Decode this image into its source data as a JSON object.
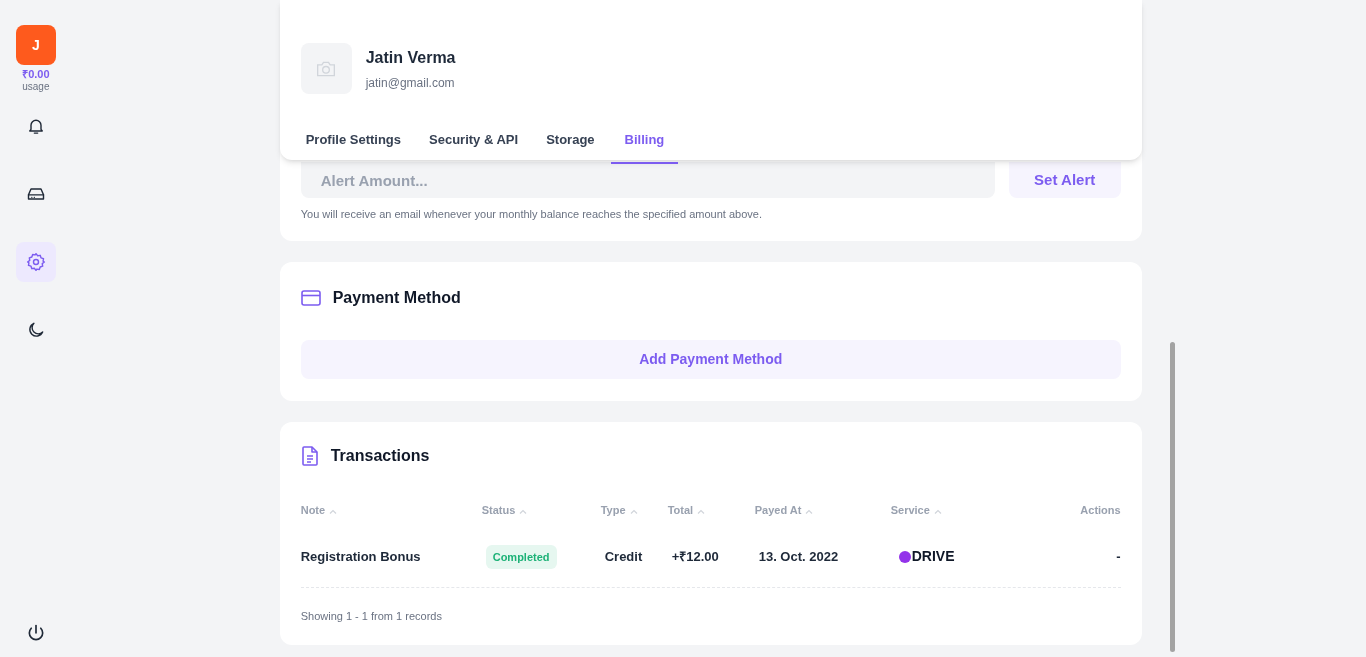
{
  "sidebar": {
    "avatar": "J",
    "usage_amount": "₹0.00",
    "usage_label": "usage",
    "items": [
      {
        "kind": "bell",
        "selected": false
      },
      {
        "kind": "drive",
        "selected": false
      },
      {
        "kind": "gear",
        "selected": true
      },
      {
        "kind": "moon",
        "selected": false
      }
    ]
  },
  "profile": {
    "name": "Jatin Verma",
    "email": "jatin@gmail.com"
  },
  "tabs": [
    {
      "label": "Profile Settings",
      "selected": false
    },
    {
      "label": "Security & API",
      "selected": false
    },
    {
      "label": "Storage",
      "selected": false
    },
    {
      "label": "Billing",
      "selected": true
    }
  ],
  "alert": {
    "placeholder": "Alert Amount...",
    "button": "Set Alert",
    "hint": "You will receive an email whenever your monthly balance reaches the specified amount above."
  },
  "payment": {
    "title": "Payment Method",
    "button": "Add Payment Method"
  },
  "transactions": {
    "title": "Transactions",
    "columns": [
      {
        "label": "Note",
        "sortable": true
      },
      {
        "label": "Status",
        "sortable": true
      },
      {
        "label": "Type",
        "sortable": true
      },
      {
        "label": "Total",
        "sortable": true
      },
      {
        "label": "Payed At",
        "sortable": true
      },
      {
        "label": "Service",
        "sortable": true
      },
      {
        "label": "Actions",
        "sortable": false
      }
    ],
    "rows": [
      {
        "note": "Registration Bonus",
        "status": "Completed",
        "type": "Credit",
        "total": "+₹12.00",
        "payed_at": "13. Oct. 2022",
        "service": "DRIVE",
        "actions": "-"
      }
    ],
    "footer": "Showing 1 - 1 from 1 records"
  }
}
